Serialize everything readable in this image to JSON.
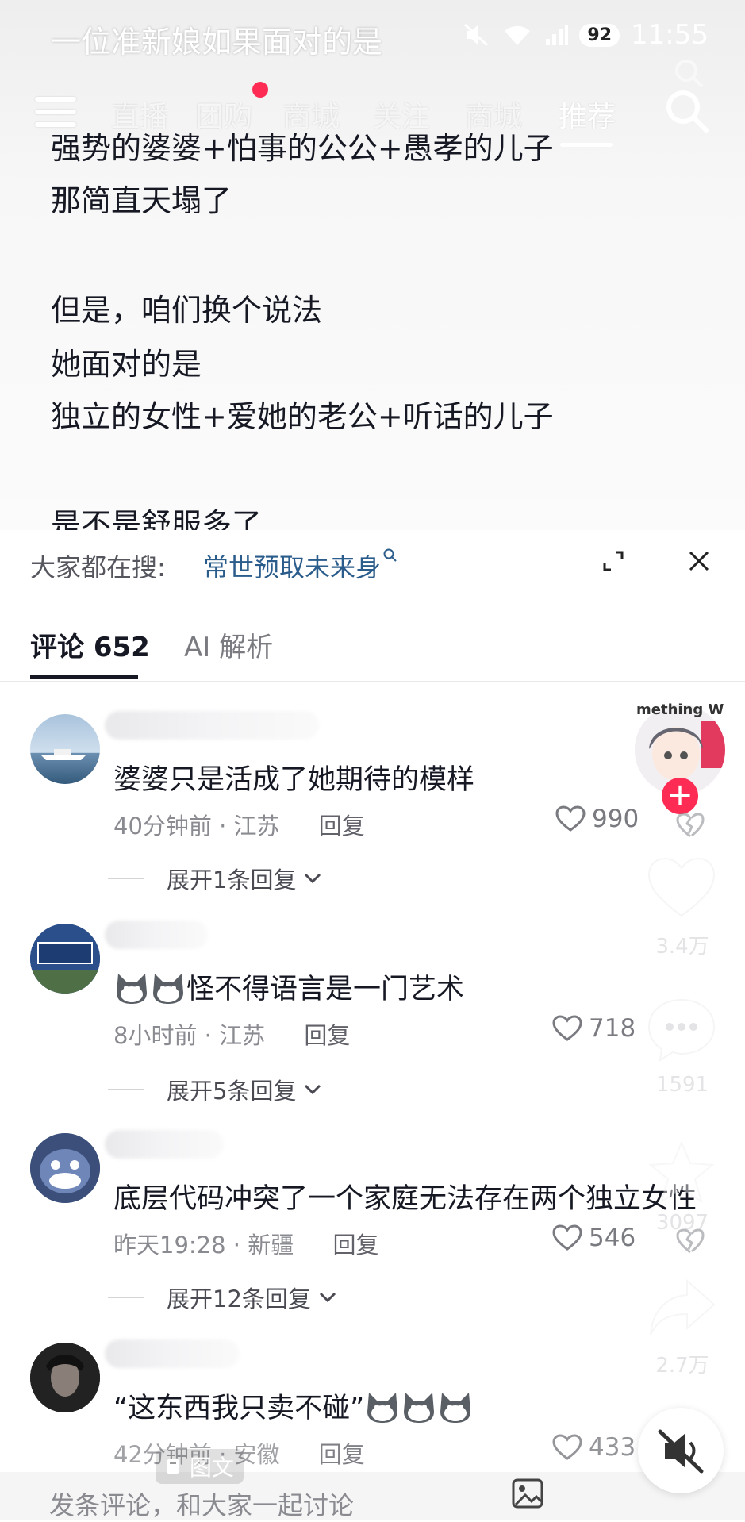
{
  "status": {
    "title": "一位准新娘如果面对的是",
    "battery": "92",
    "time": "11:55"
  },
  "nav": {
    "tabs": [
      "直播",
      "团购",
      "商城",
      "关注",
      "商城",
      "推荐"
    ],
    "search_icon": "search-icon"
  },
  "post": {
    "lines": [
      "强势的婆婆+怕事的公公+愚孝的儿子",
      "那简直天塌了",
      "但是，咱们换个说法",
      "她面对的是",
      "独立的女性+爱她的老公+听话的儿子",
      "是不是舒服多了"
    ]
  },
  "search": {
    "label": "大家都在搜:",
    "term": "常世预取未来身"
  },
  "comment_tabs": {
    "comments_label": "评论 652",
    "ai_label": "AI 解析"
  },
  "comments": [
    {
      "text": "婆婆只是活成了她期待的模样",
      "time": "40分钟前 · 江苏",
      "reply": "回复",
      "likes": "990",
      "expand": "展开1条回复"
    },
    {
      "text": "怪不得语言是一门艺术",
      "time": "8小时前 · 江苏",
      "reply": "回复",
      "likes": "718",
      "expand": "展开5条回复"
    },
    {
      "text": "底层代码冲突了一个家庭无法存在两个独立女性",
      "time": "昨天19:28 · 新疆",
      "reply": "回复",
      "likes": "546",
      "expand": "展开12条回复"
    },
    {
      "text": "“这东西我只卖不碰”",
      "time": "42分钟前 · 安徽",
      "reply": "回复",
      "likes": "433",
      "expand": ""
    }
  ],
  "side": {
    "creator_text": "mething W",
    "likes": "3.4万",
    "comments": "1591",
    "favorites": "3097",
    "shares": "2.7万"
  },
  "bottom": {
    "tuwen_label": "图文",
    "input_placeholder": "发条评论，和大家一起讨论"
  },
  "colors": {
    "accent": "#fe2c55",
    "search_term": "#2a5c8c"
  }
}
